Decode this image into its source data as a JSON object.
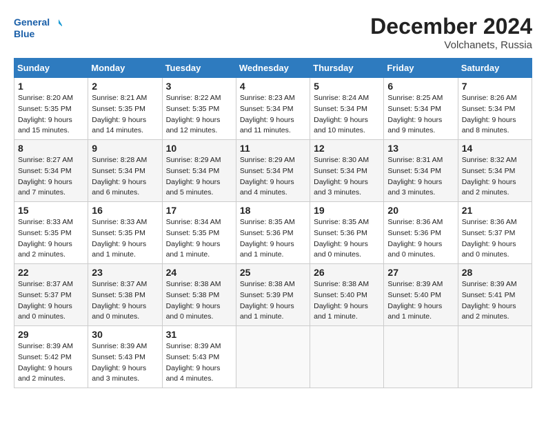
{
  "header": {
    "logo_line1": "General",
    "logo_line2": "Blue",
    "month": "December 2024",
    "location": "Volchanets, Russia"
  },
  "days_of_week": [
    "Sunday",
    "Monday",
    "Tuesday",
    "Wednesday",
    "Thursday",
    "Friday",
    "Saturday"
  ],
  "weeks": [
    [
      {
        "day": "1",
        "info": "Sunrise: 8:20 AM\nSunset: 5:35 PM\nDaylight: 9 hours and 15 minutes."
      },
      {
        "day": "2",
        "info": "Sunrise: 8:21 AM\nSunset: 5:35 PM\nDaylight: 9 hours and 14 minutes."
      },
      {
        "day": "3",
        "info": "Sunrise: 8:22 AM\nSunset: 5:35 PM\nDaylight: 9 hours and 12 minutes."
      },
      {
        "day": "4",
        "info": "Sunrise: 8:23 AM\nSunset: 5:34 PM\nDaylight: 9 hours and 11 minutes."
      },
      {
        "day": "5",
        "info": "Sunrise: 8:24 AM\nSunset: 5:34 PM\nDaylight: 9 hours and 10 minutes."
      },
      {
        "day": "6",
        "info": "Sunrise: 8:25 AM\nSunset: 5:34 PM\nDaylight: 9 hours and 9 minutes."
      },
      {
        "day": "7",
        "info": "Sunrise: 8:26 AM\nSunset: 5:34 PM\nDaylight: 9 hours and 8 minutes."
      }
    ],
    [
      {
        "day": "8",
        "info": "Sunrise: 8:27 AM\nSunset: 5:34 PM\nDaylight: 9 hours and 7 minutes."
      },
      {
        "day": "9",
        "info": "Sunrise: 8:28 AM\nSunset: 5:34 PM\nDaylight: 9 hours and 6 minutes."
      },
      {
        "day": "10",
        "info": "Sunrise: 8:29 AM\nSunset: 5:34 PM\nDaylight: 9 hours and 5 minutes."
      },
      {
        "day": "11",
        "info": "Sunrise: 8:29 AM\nSunset: 5:34 PM\nDaylight: 9 hours and 4 minutes."
      },
      {
        "day": "12",
        "info": "Sunrise: 8:30 AM\nSunset: 5:34 PM\nDaylight: 9 hours and 3 minutes."
      },
      {
        "day": "13",
        "info": "Sunrise: 8:31 AM\nSunset: 5:34 PM\nDaylight: 9 hours and 3 minutes."
      },
      {
        "day": "14",
        "info": "Sunrise: 8:32 AM\nSunset: 5:34 PM\nDaylight: 9 hours and 2 minutes."
      }
    ],
    [
      {
        "day": "15",
        "info": "Sunrise: 8:33 AM\nSunset: 5:35 PM\nDaylight: 9 hours and 2 minutes."
      },
      {
        "day": "16",
        "info": "Sunrise: 8:33 AM\nSunset: 5:35 PM\nDaylight: 9 hours and 1 minute."
      },
      {
        "day": "17",
        "info": "Sunrise: 8:34 AM\nSunset: 5:35 PM\nDaylight: 9 hours and 1 minute."
      },
      {
        "day": "18",
        "info": "Sunrise: 8:35 AM\nSunset: 5:36 PM\nDaylight: 9 hours and 1 minute."
      },
      {
        "day": "19",
        "info": "Sunrise: 8:35 AM\nSunset: 5:36 PM\nDaylight: 9 hours and 0 minutes."
      },
      {
        "day": "20",
        "info": "Sunrise: 8:36 AM\nSunset: 5:36 PM\nDaylight: 9 hours and 0 minutes."
      },
      {
        "day": "21",
        "info": "Sunrise: 8:36 AM\nSunset: 5:37 PM\nDaylight: 9 hours and 0 minutes."
      }
    ],
    [
      {
        "day": "22",
        "info": "Sunrise: 8:37 AM\nSunset: 5:37 PM\nDaylight: 9 hours and 0 minutes."
      },
      {
        "day": "23",
        "info": "Sunrise: 8:37 AM\nSunset: 5:38 PM\nDaylight: 9 hours and 0 minutes."
      },
      {
        "day": "24",
        "info": "Sunrise: 8:38 AM\nSunset: 5:38 PM\nDaylight: 9 hours and 0 minutes."
      },
      {
        "day": "25",
        "info": "Sunrise: 8:38 AM\nSunset: 5:39 PM\nDaylight: 9 hours and 1 minute."
      },
      {
        "day": "26",
        "info": "Sunrise: 8:38 AM\nSunset: 5:40 PM\nDaylight: 9 hours and 1 minute."
      },
      {
        "day": "27",
        "info": "Sunrise: 8:39 AM\nSunset: 5:40 PM\nDaylight: 9 hours and 1 minute."
      },
      {
        "day": "28",
        "info": "Sunrise: 8:39 AM\nSunset: 5:41 PM\nDaylight: 9 hours and 2 minutes."
      }
    ],
    [
      {
        "day": "29",
        "info": "Sunrise: 8:39 AM\nSunset: 5:42 PM\nDaylight: 9 hours and 2 minutes."
      },
      {
        "day": "30",
        "info": "Sunrise: 8:39 AM\nSunset: 5:43 PM\nDaylight: 9 hours and 3 minutes."
      },
      {
        "day": "31",
        "info": "Sunrise: 8:39 AM\nSunset: 5:43 PM\nDaylight: 9 hours and 4 minutes."
      },
      null,
      null,
      null,
      null
    ]
  ]
}
